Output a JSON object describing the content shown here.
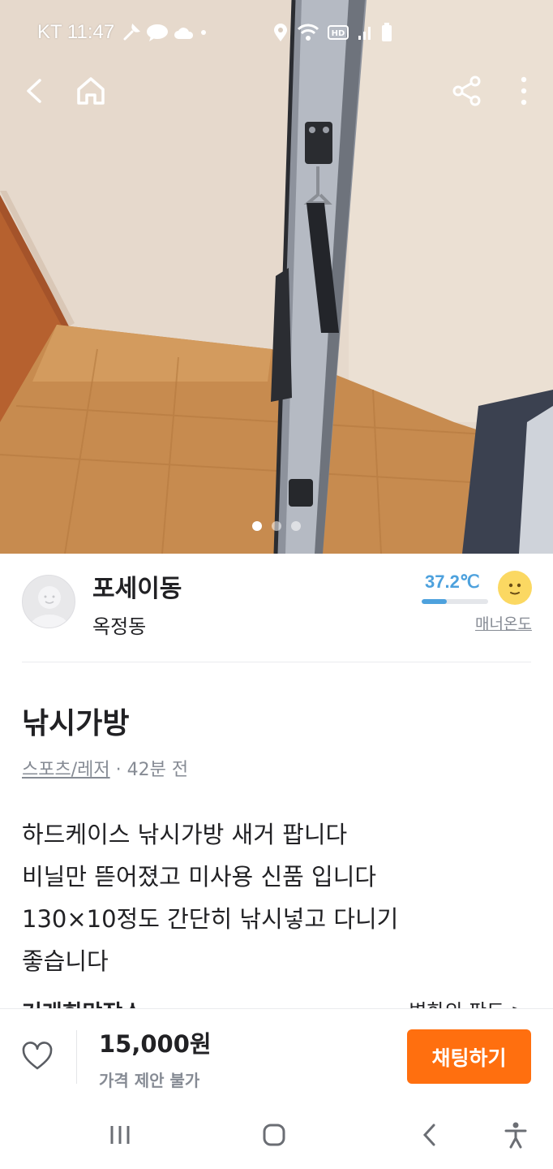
{
  "status_bar": {
    "carrier_time": "KT 11:47",
    "left_icons": [
      "wrench-icon",
      "talk-icon",
      "cloud-icon",
      "dot-icon"
    ],
    "right_icons": [
      "location-icon",
      "wifi-icon",
      "hd-icon",
      "signal-icon",
      "battery-icon"
    ]
  },
  "photo": {
    "pages": 3,
    "active_page": 1
  },
  "seller": {
    "name": "포세이동",
    "location": "옥정동",
    "temperature": "37.2℃",
    "temperature_level": 0.372,
    "manner_label": "매너온도"
  },
  "post": {
    "title": "낚시가방",
    "category": "스포츠/레저",
    "time_ago": "· 42분 전",
    "description_lines": [
      "하드케이스 낚시가방  새거 팝니다",
      "비닐만 뜯어졌고 미사용 신품 입니다",
      "130×10정도  간단히 낚시넣고 다니기",
      "좋습니다"
    ],
    "cutoff_left": "거래희망장소",
    "cutoff_right": "변화의 판도 >"
  },
  "bottom": {
    "price": "15,000원",
    "negotiation": "가격 제안 불가",
    "chat_button": "채팅하기"
  },
  "colors": {
    "accent": "#ff6f0f",
    "temperature": "#4da1dd",
    "text": "#212124",
    "muted": "#868b94"
  }
}
